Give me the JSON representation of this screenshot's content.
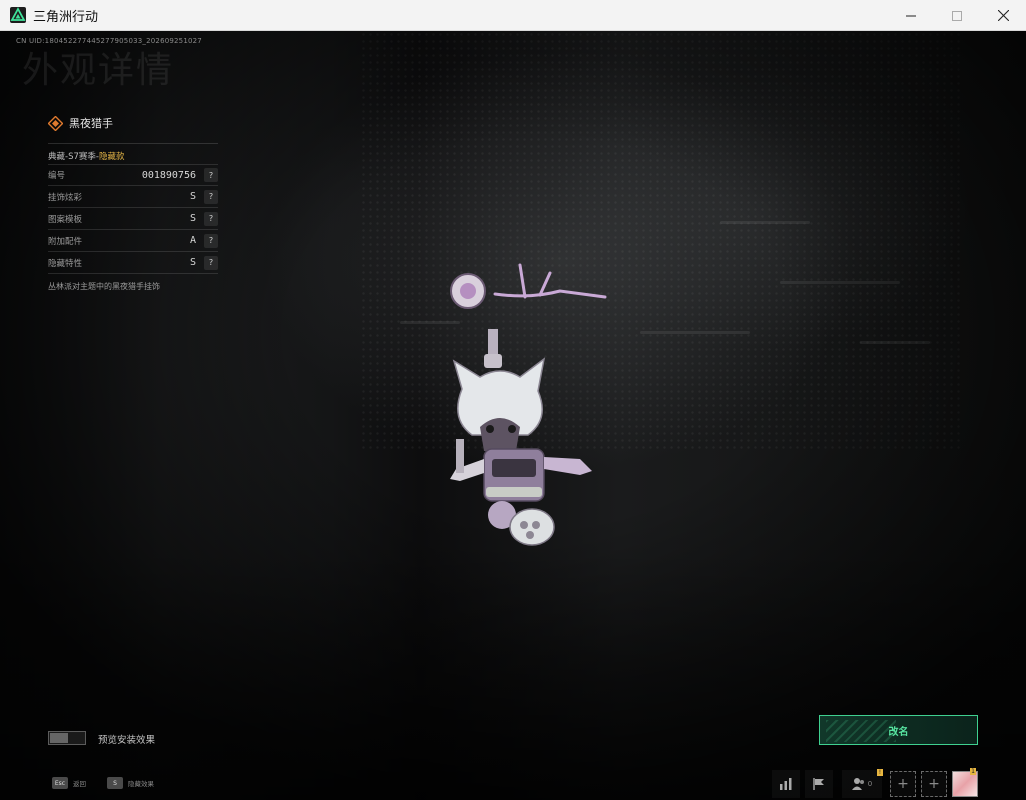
{
  "window": {
    "title": "三角洲行动"
  },
  "hud": {
    "uid": "CN UID:180452277445277905033_202609251027",
    "page_title": "外观详情"
  },
  "item": {
    "name": "黑夜猎手",
    "tier_prefix": "典藏-S7赛季-",
    "tier_highlight": "隐藏款",
    "attributes": [
      {
        "label": "编号",
        "value": "001890756",
        "help": "?"
      },
      {
        "label": "挂饰炫彩",
        "value": "S",
        "help": "?"
      },
      {
        "label": "图案模板",
        "value": "S",
        "help": "?"
      },
      {
        "label": "附加配件",
        "value": "A",
        "help": "?"
      },
      {
        "label": "隐藏特性",
        "value": "S",
        "help": "?"
      }
    ],
    "description": "丛林派对主题中的黑夜猎手挂饰"
  },
  "controls": {
    "preview_toggle_label": "预览安装效果",
    "preview_toggle_on": false,
    "rename_label": "改名"
  },
  "hints": [
    {
      "key": "Esc",
      "label": "返回"
    },
    {
      "key": "S",
      "label": "隐藏效果"
    }
  ],
  "bottom_bar": {
    "team_count": "0",
    "team_badge": "!",
    "avatar_badge": "1"
  },
  "colors": {
    "accent_green": "#57e3a0",
    "highlight_gold": "#e2b347",
    "item_icon_orange": "#e07a2e"
  }
}
